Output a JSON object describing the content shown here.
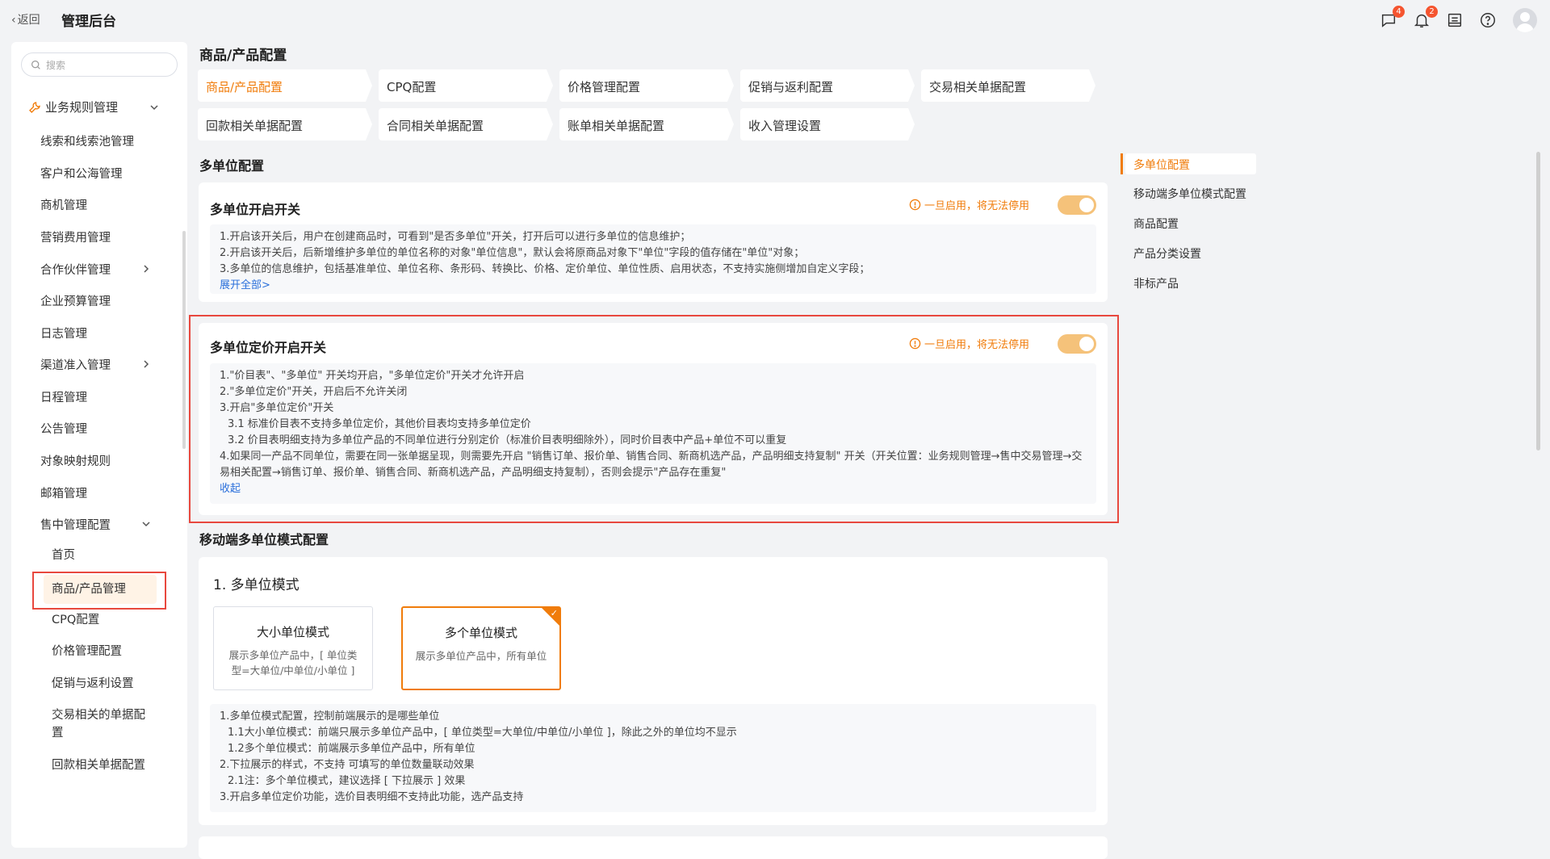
{
  "header": {
    "back_label": "返回",
    "title": "管理后台",
    "icons": [
      {
        "name": "message-icon",
        "badge": "4"
      },
      {
        "name": "bell-icon",
        "badge": "2"
      },
      {
        "name": "inbox-icon",
        "badge": ""
      },
      {
        "name": "help-icon",
        "badge": ""
      }
    ]
  },
  "sidebar": {
    "search_placeholder": "搜索",
    "group_label": "业务规则管理",
    "items": [
      "线索和线索池管理",
      "客户和公海管理",
      "商机管理",
      "营销费用管理",
      "合作伙伴管理",
      "企业预算管理",
      "日志管理",
      "渠道准入管理",
      "日程管理",
      "公告管理",
      "对象映射规则",
      "邮箱管理",
      "售中管理配置"
    ],
    "sub_items": [
      "首页",
      "商品/产品管理",
      "CPQ配置",
      "价格管理配置",
      "促销与返利设置",
      "交易相关的单据配置",
      "回款相关单据配置"
    ],
    "active_sub": "商品/产品管理"
  },
  "main": {
    "page_title": "商品/产品配置",
    "tabs": [
      "商品/产品配置",
      "CPQ配置",
      "价格管理配置",
      "促销与返利配置",
      "交易相关单据配置",
      "回款相关单据配置",
      "合同相关单据配置",
      "账单相关单据配置",
      "收入管理设置"
    ],
    "section1_title": "多单位配置",
    "card1": {
      "title": "多单位开启开关",
      "warning": "一旦启用，将无法停用",
      "lines": [
        "1.开启该开关后，用户在创建商品时，可看到\"是否多单位\"开关，打开后可以进行多单位的信息维护；",
        "2.开启该开关后，后新增维护多单位的单位名称的对象\"单位信息\"，默认会将原商品对象下\"单位\"字段的值存储在\"单位\"对象；",
        "3.多单位的信息维护，包括基准单位、单位名称、条形码、转换比、价格、定价单位、单位性质、启用状态，不支持实施侧增加自定义字段；"
      ],
      "link": "展开全部>"
    },
    "card2": {
      "title": "多单位定价开启开关",
      "warning": "一旦启用，将无法停用",
      "lines": [
        "1.\"价目表\"、\"多单位\" 开关均开启，\"多单位定价\"开关才允许开启",
        "2.\"多单位定价\"开关，开启后不允许关闭",
        "3.开启\"多单位定价\"开关",
        "3.1 标准价目表不支持多单位定价，其他价目表均支持多单位定价",
        "3.2 价目表明细支持为多单位产品的不同单位进行分别定价（标准价目表明细除外），同时价目表中产品+单位不可以重复",
        "4.如果同一产品不同单位，需要在同一张单据呈现，则需要先开启 \"销售订单、报价单、销售合同、新商机选产品，产品明细支持复制\" 开关（开关位置：业务规则管理→售中交易管理→交易相关配置→销售订单、报价单、销售合同、新商机选产品，产品明细支持复制），否则会提示\"产品存在重复\""
      ],
      "link": "收起"
    },
    "section2_title": "移动端多单位模式配置",
    "mode": {
      "heading": "1. 多单位模式",
      "options": [
        {
          "title": "大小单位模式",
          "desc": "展示多单位产品中，[ 单位类型=大单位/中单位/小单位 ]"
        },
        {
          "title": "多个单位模式",
          "desc": "展示多单位产品中，所有单位"
        }
      ],
      "selected": "多个单位模式",
      "lines": [
        "1.多单位模式配置，控制前端展示的是哪些单位",
        "1.1大小单位模式：前端只展示多单位产品中，[ 单位类型=大单位/中单位/小单位 ]，除此之外的单位均不显示",
        "1.2多个单位模式：前端展示多单位产品中，所有单位",
        "2.下拉展示的样式，不支持 可填写的单位数量联动效果",
        "2.1注：多个单位模式，建议选择 [ 下拉展示 ] 效果",
        "3.开启多单位定价功能，选价目表明细不支持此功能，选产品支持"
      ]
    }
  },
  "anchor_nav": [
    "多单位配置",
    "移动端多单位模式配置",
    "商品配置",
    "产品分类设置",
    "非标产品"
  ],
  "colors": {
    "accent": "#f07c0b",
    "warning": "#f07c0b",
    "highlight_box": "#e8483e",
    "link": "#2a6fdb"
  }
}
